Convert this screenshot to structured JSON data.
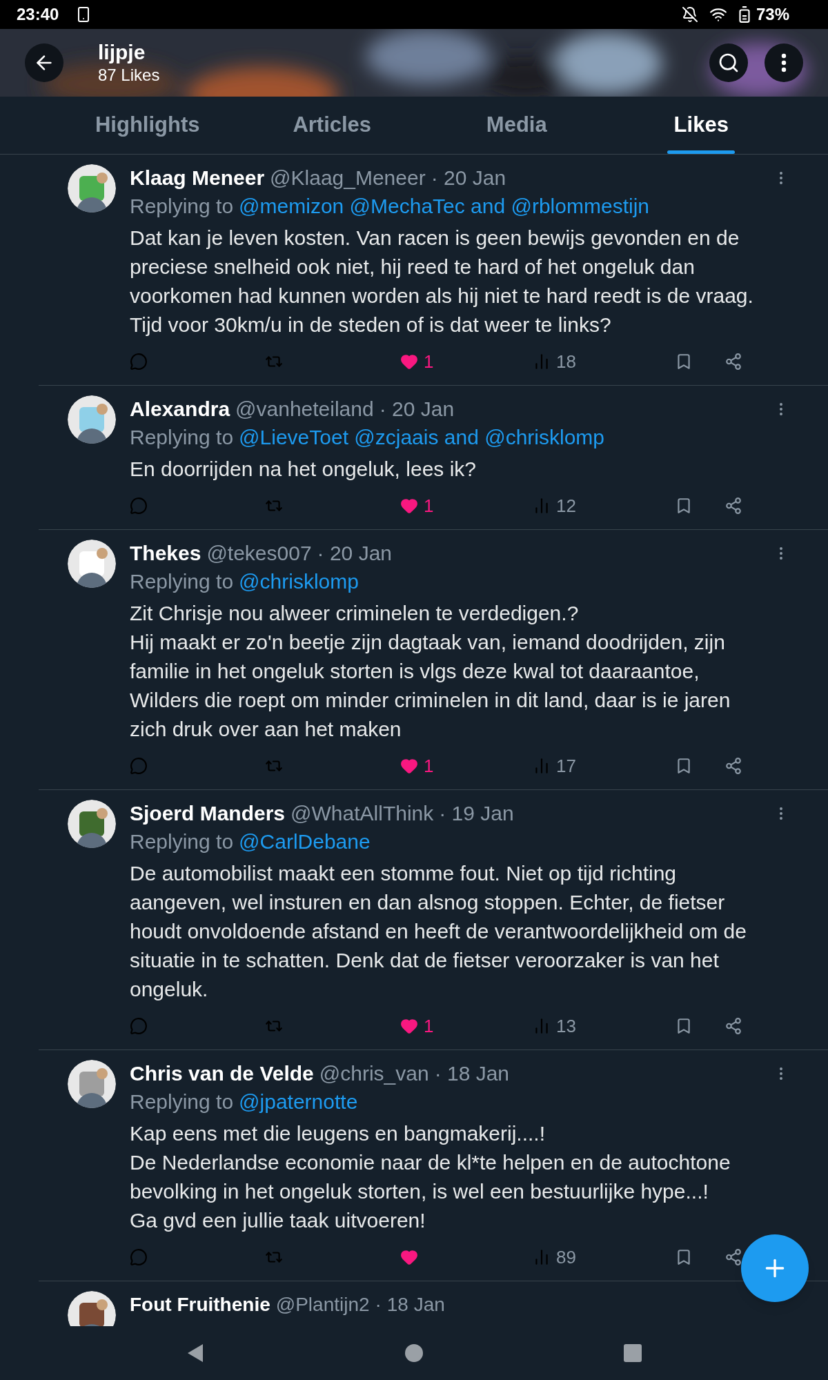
{
  "status_bar": {
    "time": "23:40",
    "battery": "73%"
  },
  "header": {
    "title": "lijpje",
    "subtitle": "87 Likes"
  },
  "tabs": [
    {
      "label": "Highlights",
      "selected": false
    },
    {
      "label": "Articles",
      "selected": false
    },
    {
      "label": "Media",
      "selected": false
    },
    {
      "label": "Likes",
      "selected": true
    }
  ],
  "tweets": [
    {
      "name": "Klaag Meneer",
      "handle": "@Klaag_Meneer",
      "date": "· 20 Jan",
      "replying_prefix": "Replying to",
      "reply_targets": "@memizon @MechaTec and @rblommestijn",
      "lines": [
        "Dat kan je leven kosten. Van racen is geen bewijs gevonden en de preciese snelheid ook niet, hij reed te hard of het ongeluk dan voorkomen had kunnen worden als hij niet te hard reedt is de vraag. Tijd voor 30km/u in de steden of is dat weer te links?"
      ],
      "liked": true,
      "likes": "1",
      "views": "18"
    },
    {
      "name": "Alexandra",
      "handle": "@vanheteiland",
      "date": "· 20 Jan",
      "replying_prefix": "Replying to",
      "reply_targets": "@LieveToet @zcjaais and @chrisklomp",
      "lines": [
        "En doorrijden na het ongeluk, lees ik?"
      ],
      "liked": true,
      "likes": "1",
      "views": "12"
    },
    {
      "name": "Thekes",
      "handle": "@tekes007",
      "date": "· 20 Jan",
      "replying_prefix": "Replying to",
      "reply_targets": "@chrisklomp",
      "lines": [
        "Zit Chrisje nou alweer criminelen te verdedigen.?",
        "Hij maakt er zo'n beetje zijn dagtaak van, iemand doodrijden, zijn familie in het ongeluk storten is vlgs deze kwal tot daaraantoe, Wilders die roept om minder criminelen in dit land, daar is ie jaren zich druk over aan het maken"
      ],
      "liked": true,
      "likes": "1",
      "views": "17"
    },
    {
      "name": "Sjoerd Manders",
      "handle": "@WhatAllThink",
      "date": "· 19 Jan",
      "replying_prefix": "Replying to",
      "reply_targets": "@CarlDebane",
      "lines": [
        "De automobilist maakt een stomme fout. Niet op tijd richting aangeven, wel insturen en dan alsnog stoppen. Echter, de fietser houdt onvoldoende afstand en heeft de verantwoordelijkheid om de situatie in te schatten. Denk dat de fietser veroorzaker is van het ongeluk."
      ],
      "liked": true,
      "likes": "1",
      "views": "13"
    },
    {
      "name": "Chris van de Velde",
      "handle": "@chris_van",
      "date": "· 18 Jan",
      "replying_prefix": "Replying to",
      "reply_targets": "@jpaternotte",
      "lines": [
        "Kap eens met die leugens en bangmakerij....!",
        "De Nederlandse economie naar de kl*te helpen en de autochtone bevolking in het ongeluk storten, is wel een bestuurlijke hype...!",
        "Ga gvd een jullie taak uitvoeren!"
      ],
      "liked": true,
      "views": "89"
    }
  ],
  "partial_tweet": {
    "name": "Fout Fruithenie",
    "handle": "@Plantijn2",
    "date": "· 18 Jan"
  }
}
